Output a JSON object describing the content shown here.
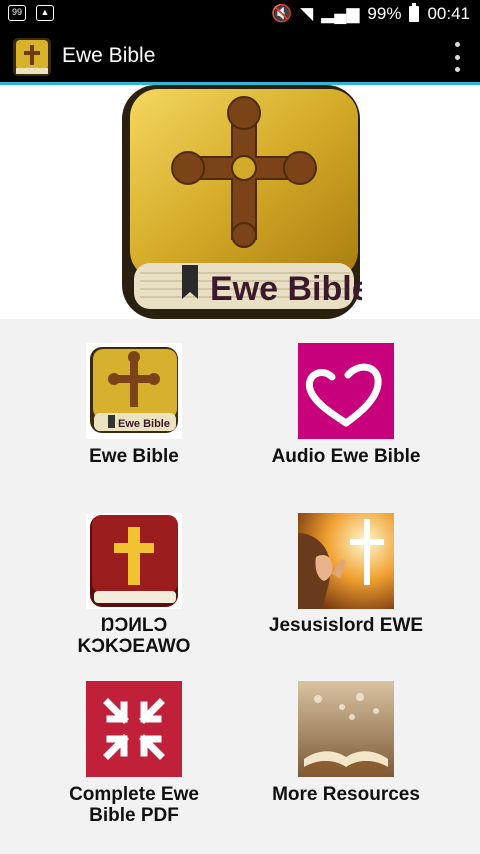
{
  "status_bar": {
    "left_icons": [
      "notification-icon",
      "image-icon"
    ],
    "battery_text": "99%",
    "time": "00:41"
  },
  "app_bar": {
    "title": "Ewe Bible",
    "menu_icon": "overflow-menu-icon"
  },
  "banner": {
    "book_label": "Ewe Bible"
  },
  "grid": {
    "items": [
      {
        "label": "Ewe Bible",
        "icon": "ewe-bible-book-icon"
      },
      {
        "label": "Audio Ewe Bible",
        "icon": "heart-icon"
      },
      {
        "label": "ŊϽИLϽ\nKϽKϽEAWO",
        "icon": "red-bible-icon"
      },
      {
        "label": "Jesusislord EWE",
        "icon": "praying-woman-cross-image"
      },
      {
        "label": "Complete Ewe\nBible PDF",
        "icon": "arrows-inward-icon"
      },
      {
        "label": "More Resources",
        "icon": "open-book-image"
      }
    ]
  },
  "colors": {
    "accent": "#2fb8d6",
    "heart_tile": "#c8007b",
    "pdf_tile": "#c0203a"
  }
}
